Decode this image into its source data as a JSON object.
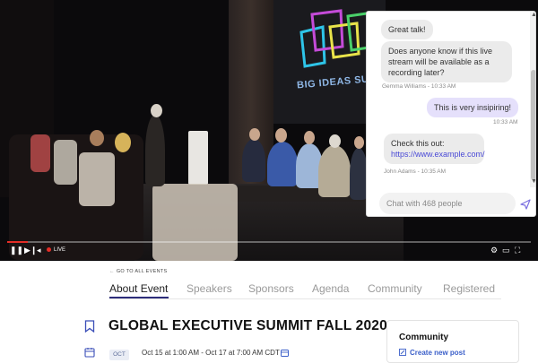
{
  "video": {
    "progress_fraction": 0.04,
    "live_label": "LIVE",
    "screen_sign": "BIG IDEAS SU"
  },
  "chat": {
    "messages": [
      {
        "kind": "in",
        "text": "Great talk!"
      },
      {
        "kind": "in",
        "text": "Does anyone know if this live stream will be available as a recording later?",
        "meta": "Gemma Williams - 10:33 AM"
      },
      {
        "kind": "out",
        "text": "This is very insipiring!",
        "meta": "10:33 AM"
      },
      {
        "kind": "in",
        "text": "Check this out:",
        "link": "https://www.example.com/",
        "meta": "John Adams - 10:35 AM"
      }
    ],
    "input_placeholder": "Chat with 468 people"
  },
  "page": {
    "back_link": "GO TO ALL EVENTS",
    "tabs": [
      "About Event",
      "Speakers",
      "Sponsors",
      "Agenda",
      "Community",
      "Registered"
    ],
    "active_tab": 0,
    "event_title": "GLOBAL EXECUTIVE SUMMIT FALL 2020",
    "month": "OCT",
    "date_range": "Oct 15 at 1:00 AM - Oct 17 at 7:00 AM CDT",
    "community": {
      "title": "Community",
      "create_post": "Create new post"
    }
  },
  "colors": {
    "accent": "#2d2d7a",
    "link": "#3b5fc9",
    "live_red": "#e52d27",
    "outgoing_bubble": "#e5e0fb"
  }
}
